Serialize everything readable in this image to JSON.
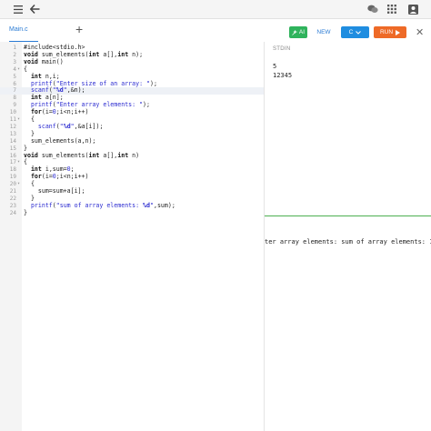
{
  "file_tab": "Main.c",
  "buttons": {
    "ai": "AI",
    "new": "NEW",
    "lang": "C",
    "run": "RUN"
  },
  "stdin": {
    "title": "STDIN",
    "lines": [
      "5",
      "12345"
    ]
  },
  "output": "ter array elements: sum of array elements: 15",
  "code": [
    {
      "n": "1",
      "fold": "",
      "t": "#include<stdio.h>"
    },
    {
      "n": "2",
      "fold": "",
      "t": "void sum_elements(int a[],int n);"
    },
    {
      "n": "3",
      "fold": "",
      "t": "void main()"
    },
    {
      "n": "4",
      "fold": "▾",
      "t": "{"
    },
    {
      "n": "5",
      "fold": "",
      "t": "  int n,i;"
    },
    {
      "n": "6",
      "fold": "",
      "t": "  printf(\"Enter size of an array: \");"
    },
    {
      "n": "7",
      "fold": "",
      "t": "  scanf(\"%d\",&n);"
    },
    {
      "n": "8",
      "fold": "",
      "t": "  int a[n];"
    },
    {
      "n": "9",
      "fold": "",
      "t": "  printf(\"Enter array elements: \");"
    },
    {
      "n": "10",
      "fold": "",
      "t": "  for(i=0;i<n;i++)"
    },
    {
      "n": "11",
      "fold": "▾",
      "t": "  {"
    },
    {
      "n": "12",
      "fold": "",
      "t": "    scanf(\"%d\",&a[i]);"
    },
    {
      "n": "13",
      "fold": "",
      "t": "  }"
    },
    {
      "n": "14",
      "fold": "",
      "t": "  sum_elements(a,n);"
    },
    {
      "n": "15",
      "fold": "",
      "t": "}"
    },
    {
      "n": "16",
      "fold": "",
      "t": "void sum_elements(int a[],int n)"
    },
    {
      "n": "17",
      "fold": "▾",
      "t": "{"
    },
    {
      "n": "18",
      "fold": "",
      "t": "  int i,sum=0;"
    },
    {
      "n": "19",
      "fold": "",
      "t": "  for(i=0;i<n;i++)"
    },
    {
      "n": "20",
      "fold": "▾",
      "t": "  {"
    },
    {
      "n": "21",
      "fold": "",
      "t": "    sum=sum+a[i];"
    },
    {
      "n": "22",
      "fold": "",
      "t": "  }"
    },
    {
      "n": "23",
      "fold": "",
      "t": "  printf(\"sum of array elements: %d\",sum);"
    },
    {
      "n": "24",
      "fold": "",
      "t": "}"
    }
  ],
  "active_line": 7,
  "colors": {
    "accent": "#2a7bd4",
    "ai": "#2fb35c",
    "lang": "#1f8de0",
    "run": "#ee6a27",
    "divider": "#4caf50"
  }
}
